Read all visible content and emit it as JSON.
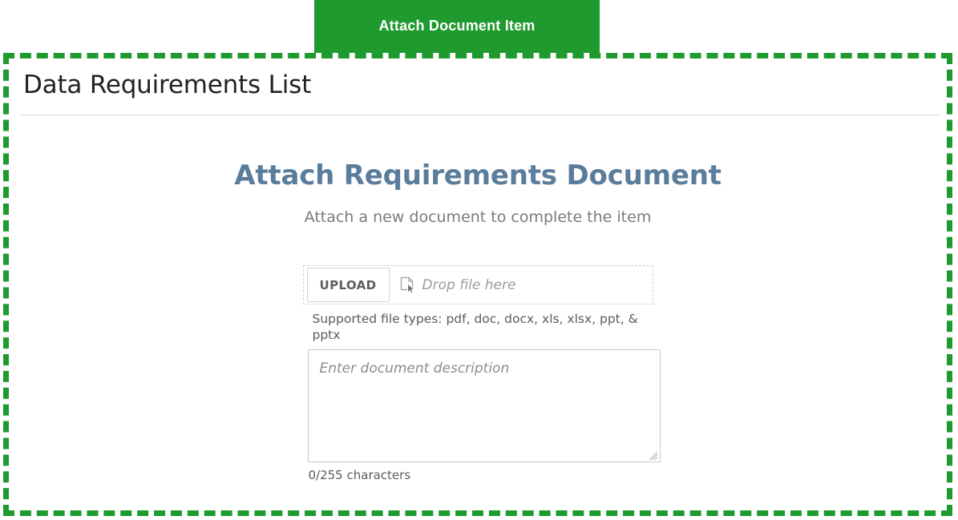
{
  "tab": {
    "label": "Attach Document Item"
  },
  "panel": {
    "title": "Data Requirements List"
  },
  "form": {
    "heading": "Attach Requirements Document",
    "subheading": "Attach a new document to complete the item",
    "upload_button_label": "UPLOAD",
    "dropzone_placeholder": "Drop file here",
    "dropzone_icon": "document-drop-cursor-icon",
    "supported_file_types": "Supported file types: pdf, doc, docx, xls, xlsx, ppt, & pptx",
    "description_placeholder": "Enter document description",
    "description_value": "",
    "character_count": "0/255 characters"
  },
  "colors": {
    "tab_green": "#1f9a2e",
    "highlight_dashed_green": "#1f9a2e",
    "heading_slate_blue": "#5b7d9c",
    "panel_title_dark": "#222222",
    "muted_text": "#7b7b7b",
    "placeholder_gray": "#9b9b9b",
    "border_gray": "#c8c8c8"
  }
}
